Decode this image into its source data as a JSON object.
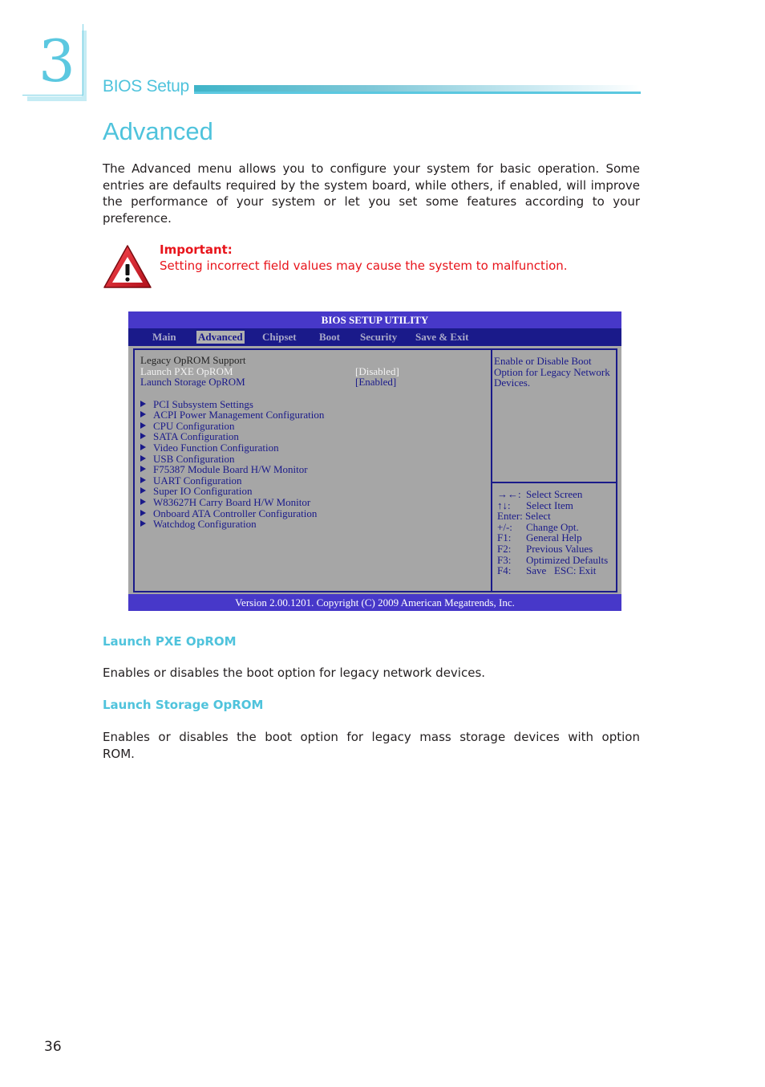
{
  "header": {
    "chapter_number": "3",
    "section_label": "BIOS Setup"
  },
  "page": {
    "title": "Advanced",
    "intro": "The Advanced menu allows you to configure your system for basic operation. Some entries are defaults required by the system board, while others, if enabled, will improve the performance of your system or let you set some features according to your preference.",
    "page_number": "36"
  },
  "notice": {
    "icon": "warning-triangle-icon",
    "label": "Important:",
    "text": "Setting incorrect field values may cause the system to malfunction.",
    "color": "#e8141b"
  },
  "bios": {
    "title": "BIOS SETUP UTILITY",
    "tabs": [
      {
        "label": "Main",
        "active": false
      },
      {
        "label": "Advanced",
        "active": true
      },
      {
        "label": "Chipset",
        "active": false
      },
      {
        "label": "Boot",
        "active": false
      },
      {
        "label": "Security",
        "active": false
      },
      {
        "label": "Save & Exit",
        "active": false
      }
    ],
    "section_heading": "Legacy OpROM Support",
    "settings": [
      {
        "label": "Launch PXE OpROM",
        "value": "[Disabled]",
        "selected": true
      },
      {
        "label": "Launch Storage OpROM",
        "value": "[Enabled]",
        "selected": false
      }
    ],
    "submenus": [
      "PCI Subsystem Settings",
      "ACPI Power Management Configuration",
      "CPU Configuration",
      "SATA Configuration",
      "Video Function Configuration",
      "USB Configuration",
      "F75387 Module Board H/W Monitor",
      "UART Configuration",
      "Super IO Configuration",
      "W83627H Carry Board H/W Monitor",
      "Onboard ATA Controller Configuration",
      "Watchdog Configuration"
    ],
    "help_text": "Enable or Disable Boot Option for Legacy Network Devices.",
    "keys": [
      {
        "key": "→←:",
        "action": "Select Screen"
      },
      {
        "key": "↑↓:",
        "action": "Select Item"
      },
      {
        "key": "Enter:",
        "action": "Select"
      },
      {
        "key": "+/-:",
        "action": "Change Opt."
      },
      {
        "key": "F1:",
        "action": "General Help"
      },
      {
        "key": "F2:",
        "action": "Previous Values"
      },
      {
        "key": "F3:",
        "action": "Optimized Defaults"
      },
      {
        "key": "F4:",
        "action": "Save   ESC: Exit"
      }
    ],
    "footer": "Version 2.00.1201. Copyright (C) 2009 American Megatrends, Inc.",
    "colors": {
      "title_bar": "#4738c9",
      "menu_bar": "#1a1a8a",
      "panel": "#a6a6a6"
    }
  },
  "descriptions": [
    {
      "heading": "Launch PXE OpROM",
      "text": "Enables or disables the boot option for legacy network devices."
    },
    {
      "heading": "Launch Storage OpROM",
      "text": "Enables or disables the boot option for legacy mass storage devices with option ROM."
    }
  ],
  "accent_color": "#4fc3dc"
}
